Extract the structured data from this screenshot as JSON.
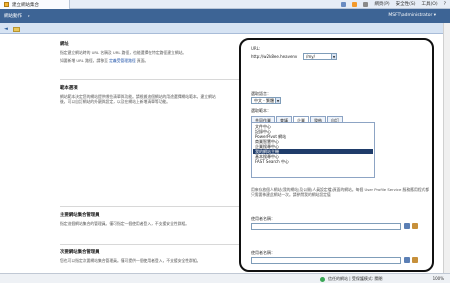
{
  "browser": {
    "tab_title": "建立網站集合",
    "toolbar": {
      "page_label": "網頁(P)",
      "safety_label": "安全性(S)",
      "tools_label": "工具(O)",
      "help_label": "?"
    }
  },
  "site": {
    "nav_left": "網站動作",
    "user_menu": "MSFT\\administrator ▾"
  },
  "sections": {
    "address": {
      "title": "網址",
      "text": "指定建立網站時的 URL 名稱及 URL 路徑，也能選擇在特定路徑建立網站。",
      "text2": "如要新增 URL 路徑，請移至 ",
      "link": "定義受管理路徑",
      "text3": " 頁面。"
    },
    "template": {
      "title": "範本選項",
      "text": "網站範本決定您的網站提供哪些清單與功能。請根據這個網站的用途選擇網站範本。建立網站後，可以自訂網站的外觀與設定，以及在網站上新增清單等功能。"
    },
    "primary_admin": {
      "title": "主要網站集合管理員",
      "text": "指定這個網站集合的管理員。僅可指定一個使用者登入，不支援安全性群組。"
    },
    "secondary_admin": {
      "title": "次要網站集合管理員",
      "text": "您也可以指定次要網站集合管理員。僅可提供一個使用者登入，不支援安全性群組。"
    }
  },
  "panel": {
    "url_label": "URL:",
    "url_prefix": "http://w2k8ee.heavenv",
    "url_path": "/my/",
    "language_label": "選取語言：",
    "language_value": "中文 - 繁體",
    "template_label": "選取範本：",
    "tabs": [
      "共同作業",
      "會議",
      "企業",
      "發佈",
      "自訂"
    ],
    "active_tab": 2,
    "template_items": [
      "文件中心",
      "記錄中心",
      "PowerPivot 網站",
      "商業智慧中心",
      "企業搜尋中心",
      "我的網站主機",
      "基本搜尋中心",
      "FAST Search 中心"
    ],
    "selected_item": 5,
    "description": "用來存放個人網站(我的網站)及公開(人員設定檔)頁面的網站。每個 User Profile Service 服務應用程式都只需要佈建此網站一次。請參閱我的網站設定值",
    "primary_label": "使用者名稱：",
    "secondary_label": "使用者名稱："
  },
  "status": {
    "message": "信任的網站 | 受保護模式: 關閉",
    "zoom": "100%"
  }
}
